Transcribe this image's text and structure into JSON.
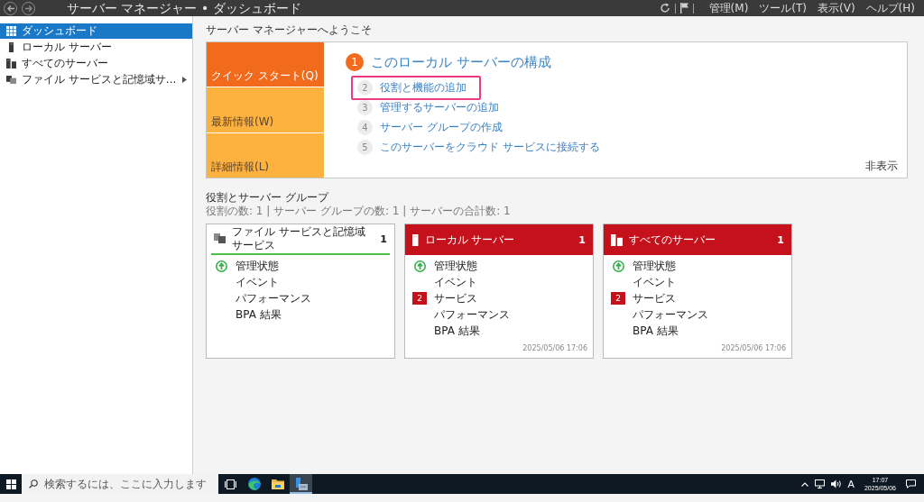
{
  "window": {
    "title": "サーバー マネージャー • ダッシュボード",
    "menu": [
      "管理(M)",
      "ツール(T)",
      "表示(V)",
      "ヘルプ(H)"
    ]
  },
  "sidebar": {
    "items": [
      {
        "kind": "dashboard",
        "label": "ダッシュボード",
        "selected": true,
        "expandable": false
      },
      {
        "kind": "server",
        "label": "ローカル サーバー",
        "selected": false,
        "expandable": false
      },
      {
        "kind": "servers",
        "label": "すべてのサーバー",
        "selected": false,
        "expandable": false
      },
      {
        "kind": "storage",
        "label": "ファイル サービスと記憶域サ...",
        "selected": false,
        "expandable": true
      }
    ]
  },
  "welcome": {
    "heading": "サーバー マネージャーへようこそ",
    "tabs": [
      {
        "label": "クイック スタート(Q)",
        "selected": true
      },
      {
        "label": "最新情報(W)",
        "selected": false
      },
      {
        "label": "詳細情報(L)",
        "selected": false
      }
    ],
    "step": "1",
    "title": "このローカル サーバーの構成",
    "tasks": [
      {
        "number": "2",
        "label": "役割と機能の追加",
        "highlighted": true
      },
      {
        "number": "3",
        "label": "管理するサーバーの追加",
        "highlighted": false
      },
      {
        "number": "4",
        "label": "サーバー グループの作成",
        "highlighted": false
      },
      {
        "number": "5",
        "label": "このサーバーをクラウド サービスに接続する",
        "highlighted": false
      }
    ],
    "hide_link": "非表示"
  },
  "roles": {
    "title": "役割とサーバー グループ",
    "summary": "役割の数: 1 | サーバー グループの数: 1 | サーバーの合計数: 1",
    "tiles": [
      {
        "kind": "storage",
        "title": "ファイル サービスと記憶域サービス",
        "count": "1",
        "alert": false,
        "rows": [
          {
            "kind": "status",
            "label": "管理状態"
          },
          {
            "kind": "plain",
            "label": "イベント"
          },
          {
            "kind": "plain",
            "label": "パフォーマンス"
          },
          {
            "kind": "plain",
            "label": "BPA 結果"
          }
        ]
      },
      {
        "kind": "server",
        "title": "ローカル サーバー",
        "count": "1",
        "alert": true,
        "rows": [
          {
            "kind": "status",
            "label": "管理状態"
          },
          {
            "kind": "plain",
            "label": "イベント"
          },
          {
            "kind": "alert",
            "count": "2",
            "label": "サービス"
          },
          {
            "kind": "plain",
            "label": "パフォーマンス"
          },
          {
            "kind": "plain",
            "label": "BPA 結果"
          }
        ],
        "updated": "2025/05/06 17:06"
      },
      {
        "kind": "servers",
        "title": "すべてのサーバー",
        "count": "1",
        "alert": true,
        "rows": [
          {
            "kind": "status",
            "label": "管理状態"
          },
          {
            "kind": "plain",
            "label": "イベント"
          },
          {
            "kind": "alert",
            "count": "2",
            "label": "サービス"
          },
          {
            "kind": "plain",
            "label": "パフォーマンス"
          },
          {
            "kind": "plain",
            "label": "BPA 結果"
          }
        ],
        "updated": "2025/05/06 17:06"
      }
    ]
  },
  "taskbar": {
    "search": {
      "placeholder": "検索するには、ここに入力します"
    },
    "apps": [
      {
        "kind": "task_view",
        "selected": false
      },
      {
        "kind": "browser",
        "selected": false
      },
      {
        "kind": "folder",
        "selected": false
      },
      {
        "kind": "server_manager",
        "selected": true
      }
    ],
    "tray": {
      "ime": "A",
      "time": "17:07",
      "date": "2025/05/06"
    }
  }
}
